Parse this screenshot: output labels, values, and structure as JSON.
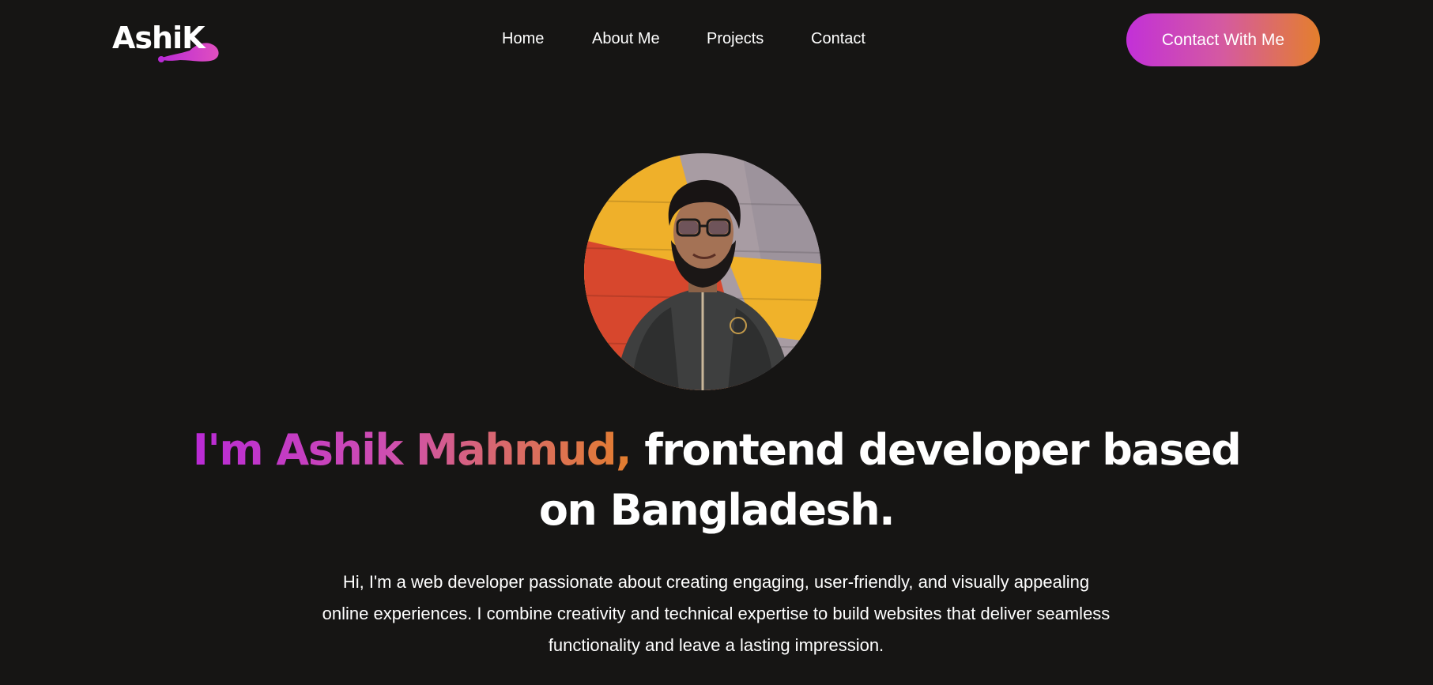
{
  "header": {
    "logo_text": "AshiK",
    "nav": [
      {
        "label": "Home"
      },
      {
        "label": "About Me"
      },
      {
        "label": "Projects"
      },
      {
        "label": "Contact"
      }
    ],
    "cta_label": "Contact With Me"
  },
  "hero": {
    "avatar_icon": "profile-photo",
    "headline_highlight": "I'm Ashik Mahmud,",
    "headline_rest_line1": " frontend developer based",
    "headline_line2": "on Bangladesh.",
    "intro": "Hi, I'm a web developer passionate about creating engaging, user-friendly, and visually appealing online experiences. I combine creativity and technical expertise to build websites that deliver seamless functionality and leave a lasting impression."
  },
  "colors": {
    "background": "#161514",
    "gradient_start": "#c230d8",
    "gradient_end": "#e47f2c",
    "text": "#ffffff"
  }
}
